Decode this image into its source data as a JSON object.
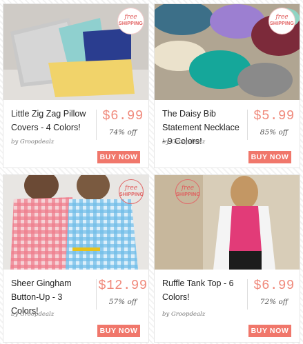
{
  "products": [
    {
      "title": "Little Zig Zag Pillow Covers - 4 Colors!",
      "price": "$6.99",
      "discount": "74% off",
      "by": "by Groopdealz",
      "button": "BUY NOW",
      "badge_line1": "free",
      "badge_line2": "SHIPPING"
    },
    {
      "title": "The Daisy Bib Statement Necklace - 9 Colors!",
      "price": "$5.99",
      "discount": "85% off",
      "by": "by Groopdealz",
      "button": "BUY NOW",
      "badge_line1": "free",
      "badge_line2": "SHIPPING"
    },
    {
      "title": "Sheer Gingham Button-Up - 3 Colors!",
      "price": "$12.99",
      "discount": "57% off",
      "by": "by Groopdealz",
      "button": "BUY NOW",
      "badge_line1": "free",
      "badge_line2": "SHIPPING"
    },
    {
      "title": "Ruffle Tank Top - 6 Colors!",
      "price": "$6.99",
      "discount": "72% off",
      "by": "by Groopdealz",
      "button": "BUY NOW",
      "badge_line1": "free",
      "badge_line2": "SHIPPING"
    }
  ],
  "colors": {
    "price": "#f08a7c",
    "button": "#f0776b",
    "badge": "#e05a5a"
  }
}
